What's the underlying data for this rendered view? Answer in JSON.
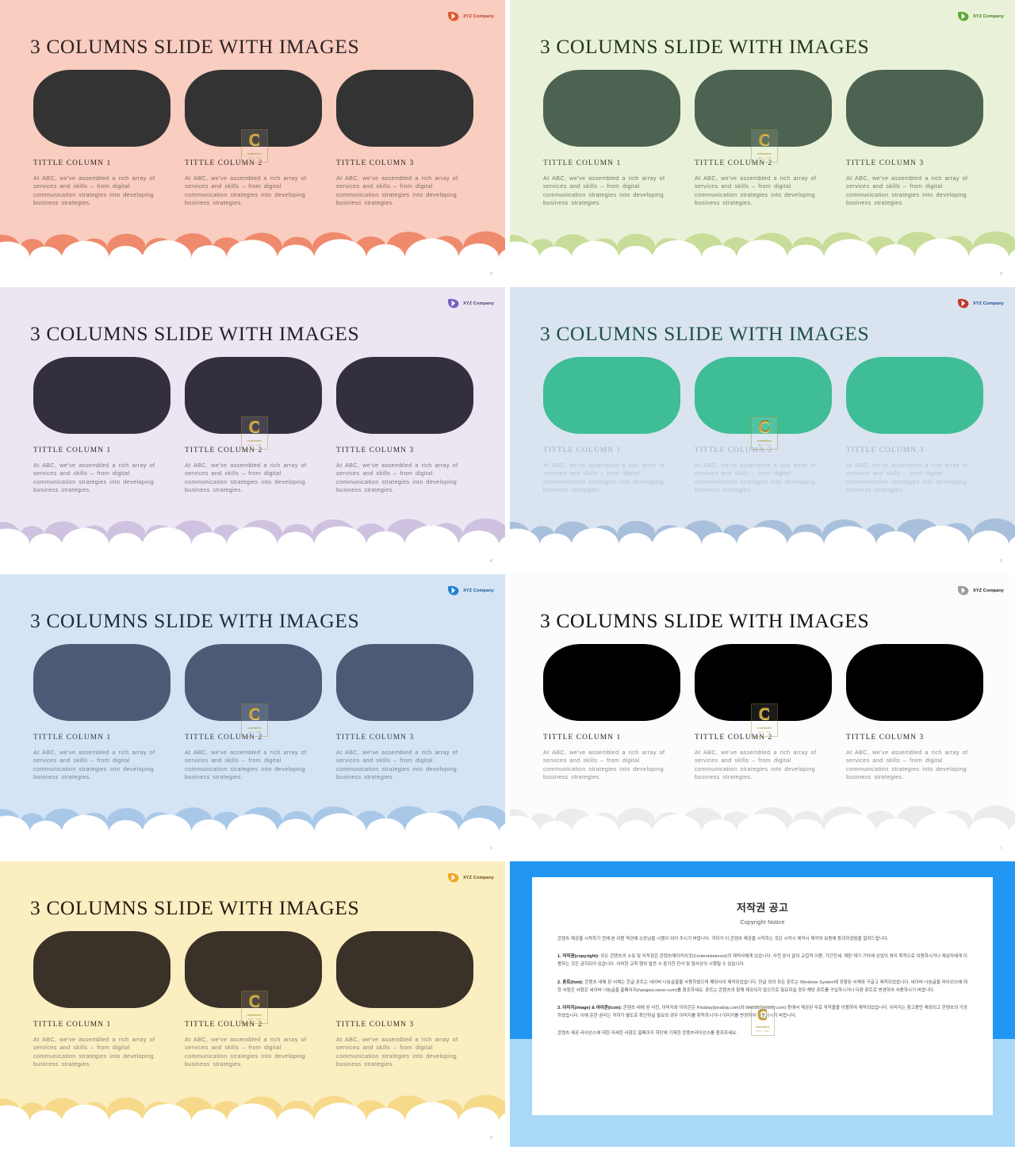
{
  "common": {
    "title": "3 COLUMNS SLIDE WITH IMAGES",
    "logo_text": "XYZ Company",
    "logo_mark_icon": "leaf-swoosh-logo-icon",
    "watermark": {
      "letter": "C",
      "line1": "CONTENTS",
      "line2": "MALL . COM",
      "icon": "contents-watermark-icon"
    },
    "columns": [
      {
        "title": "TITTLE  COLUMN 1",
        "body": "At ABC, we've assembled a rich array of services and skills – from digital communication strategies into developing business strategies."
      },
      {
        "title": "TITTLE  COLUMN 2",
        "body": "At ABC, we've assembled a rich array of services and skills – from digital communication strategies into developing business strategies."
      },
      {
        "title": "TITTLE  COLUMN 3",
        "body": "At ABC, we've assembled a rich array of services and skills – from digital communication strategies into developing business strategies."
      }
    ]
  },
  "slides": [
    {
      "id": "slide-pink",
      "page": "2",
      "bg": "#f9cdc0",
      "title_color": "#2b2222",
      "thumb_color": "#333333",
      "col_title_color": "#2c2222",
      "body_color": "#7d6b66",
      "cloud_back": "#ef8a6d",
      "cloud_front": "#ffffff",
      "logo_color": "#e2572c",
      "logo_text_color": "#c0392b",
      "page_color": "#d98c76"
    },
    {
      "id": "slide-green-light",
      "page": "3",
      "bg": "#e9f2d8",
      "title_color": "#22361f",
      "thumb_color": "#4b6350",
      "col_title_color": "#2a3a26",
      "body_color": "#6f7a68",
      "cloud_back": "#c9dd9a",
      "cloud_front": "#ffffff",
      "logo_color": "#5fa832",
      "logo_text_color": "#3d7a1c",
      "page_color": "#9ab377"
    },
    {
      "id": "slide-lavender",
      "page": "4",
      "bg": "#ece6f2",
      "title_color": "#241f2e",
      "thumb_color": "#332f3f",
      "col_title_color": "#2b2636",
      "body_color": "#7b7487",
      "cloud_back": "#cfc2e0",
      "cloud_front": "#ffffff",
      "logo_color": "#7a5ec4",
      "logo_text_color": "#4b3b72",
      "page_color": "#a99bc0"
    },
    {
      "id": "slide-teal",
      "page": "5",
      "bg": "#d9e4f0",
      "title_color": "#1f4f4a",
      "thumb_color": "#3fbd96",
      "col_title_color": "#9fb0c2",
      "body_color": "#b3c1d0",
      "cloud_back": "#a9c0dc",
      "cloud_front": "#ffffff",
      "logo_color": "#c0392b",
      "logo_text_color": "#1f4f8f",
      "page_color": "#a9bbcf"
    },
    {
      "id": "slide-blue",
      "page": "6",
      "bg": "#d5e4f4",
      "title_color": "#1f2a3a",
      "thumb_color": "#4b5a75",
      "col_title_color": "#273448",
      "body_color": "#73839a",
      "cloud_back": "#a9c8e8",
      "cloud_front": "#ffffff",
      "logo_color": "#1f7fd0",
      "logo_text_color": "#14558f",
      "page_color": "#9fb8d4"
    },
    {
      "id": "slide-white",
      "page": "7",
      "bg": "#fcfcfc",
      "title_color": "#121212",
      "thumb_color": "#000000",
      "col_title_color": "#1a1a1a",
      "body_color": "#8a8a8a",
      "cloud_back": "#ececec",
      "cloud_front": "#ffffff",
      "logo_color": "#9b9b9b",
      "logo_text_color": "#1a1a1a",
      "page_color": "#b5b5b5"
    },
    {
      "id": "slide-cream",
      "page": "8",
      "bg": "#fbeec1",
      "title_color": "#231c12",
      "thumb_color": "#3a3228",
      "col_title_color": "#2a2218",
      "body_color": "#8d8272",
      "cloud_back": "#f6d98a",
      "cloud_front": "#ffffff",
      "logo_color": "#f1a723",
      "logo_text_color": "#6b4a10",
      "page_color": "#cbb576"
    }
  ],
  "copyright": {
    "id": "slide-copyright",
    "page": "",
    "bg_top": "#2196f3",
    "bg_bottom": "#aad8f7",
    "title": "저작권 공고",
    "subtitle": "Copyright Notice",
    "intro": "콘텐츠 제공을 시작하기 전에 본 이용 약관에 소장님을 시행이 되어 주시기 바랍니다. 귀하가 이 콘텐츠 제공을 시작하는 것은 시작시 제작시 제작의 보증에 동의하셨음을 알려드립니다.",
    "para1_label": "1. 저작권(copyright):",
    "para1": "모든 콘텐츠의 소유 및 저작권은 콘텐츠메이커의것(Contentstakeout)의 제작사에게 있습니다. 사전 승낙 없이 교집적 이용, 가간전세, 재판 재기 기타에 상업이 영리 목적으로 이용하시거나 제삼자에게 이용하는 것은 금지되어 있습니다. 이러한 교칙 행위 발견 시 중지한 민사 및 형사상의 시행될 수 있습니다.",
    "para2_label": "2. 폰트(font):",
    "para2": "콘텐츠 내에 된 서체는 한글 폰트는 네이버 나눔글꼴을 사용하였으며 해당사이 제작되었습니다. 한글 외의 모든 폰트는 Windows System에 포함된 서체와 구글고 제작되었습니다. 네이버 나눔글꼴 라이선스에 대한 사항은 사항은 네이버 나눔글꼴 홈페이지(hangeul.naver.com)를 참조하세요. 폰트는 콘텐츠의 함께 제공되지 않으므로 필요하실 경우 해당 폰트를 구입하시거나 다른 폰트로 변경하여 사용하시기 바랍니다.",
    "para3_label": "3. 이미지(image) & 아이콘(icon):",
    "para3": "콘텐츠 내에 된 사진, 이미지와 아이콘은 Pixabay(pixabay.com)와 Webdly(webdly.com) 등에서 제공된 무료 저작물을 이용하여 제작되었습니다. 이미지는 참고용만 제공되고 콘텐츠의 가공하였습니다. 이에 준한 권리는 귀하가 별도로 확인하실 필요와 경우 이미지를 취득하시거나 이미지를 변경하여 사용하시기 바랍니다.",
    "footer": "콘텐츠 제공 라이선스에 대한 자세한 사항은 홈페이지 하단에 기재한 콘텐츠라이선스를 참조하세요."
  }
}
